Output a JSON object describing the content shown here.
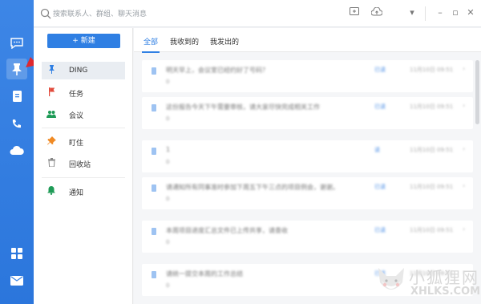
{
  "search": {
    "placeholder": "搜索联系人、群组、聊天消息"
  },
  "nav": {
    "new_label": "+ 新建",
    "items": [
      {
        "label": "DING",
        "icon": "pin-icon",
        "color": "#2f7fe3"
      },
      {
        "label": "任务",
        "icon": "flag-icon",
        "color": "#e24a3b"
      },
      {
        "label": "会议",
        "icon": "people-icon",
        "color": "#1f9b57"
      },
      {
        "label": "盯住",
        "icon": "pin-orange-icon",
        "color": "#f08a24"
      },
      {
        "label": "回收站",
        "icon": "trash-icon",
        "color": "#888888"
      },
      {
        "label": "通知",
        "icon": "bell-icon",
        "color": "#1f9b57"
      }
    ]
  },
  "tabs": [
    {
      "label": "全部"
    },
    {
      "label": "我收到的"
    },
    {
      "label": "我发出的"
    }
  ],
  "messages": [
    {
      "text": "明天早上，会议室已经约好了号码？",
      "sub": "0",
      "tag": "已读",
      "time": "11月10日 09:51"
    },
    {
      "text": "这份报告今天下午需要审核，请大家尽快完成相关工作",
      "sub": "0",
      "tag": "已读",
      "time": "11月10日 09:51"
    },
    {
      "text": "1",
      "sub": "0",
      "tag": "读",
      "time": "11月10日 09:51"
    },
    {
      "text": "请通知所有同事准时参加下周五下午三点的项目例会，谢谢。",
      "sub": "0",
      "tag": "已读",
      "time": "11月10日 09:51"
    },
    {
      "text": "本周项目进度汇总文件已上传共享，请查收",
      "sub": "0",
      "tag": "已读",
      "time": "11月10日 09:51"
    },
    {
      "text": "请统一提交本周的工作总结",
      "sub": "0",
      "tag": "已读",
      "time": "11月10日 09:51"
    }
  ],
  "watermark": {
    "cn": "小狐狸网",
    "en": "XHLKS.COM"
  },
  "colors": {
    "accent": "#2f7fe3",
    "rail": "#3d86e6"
  }
}
